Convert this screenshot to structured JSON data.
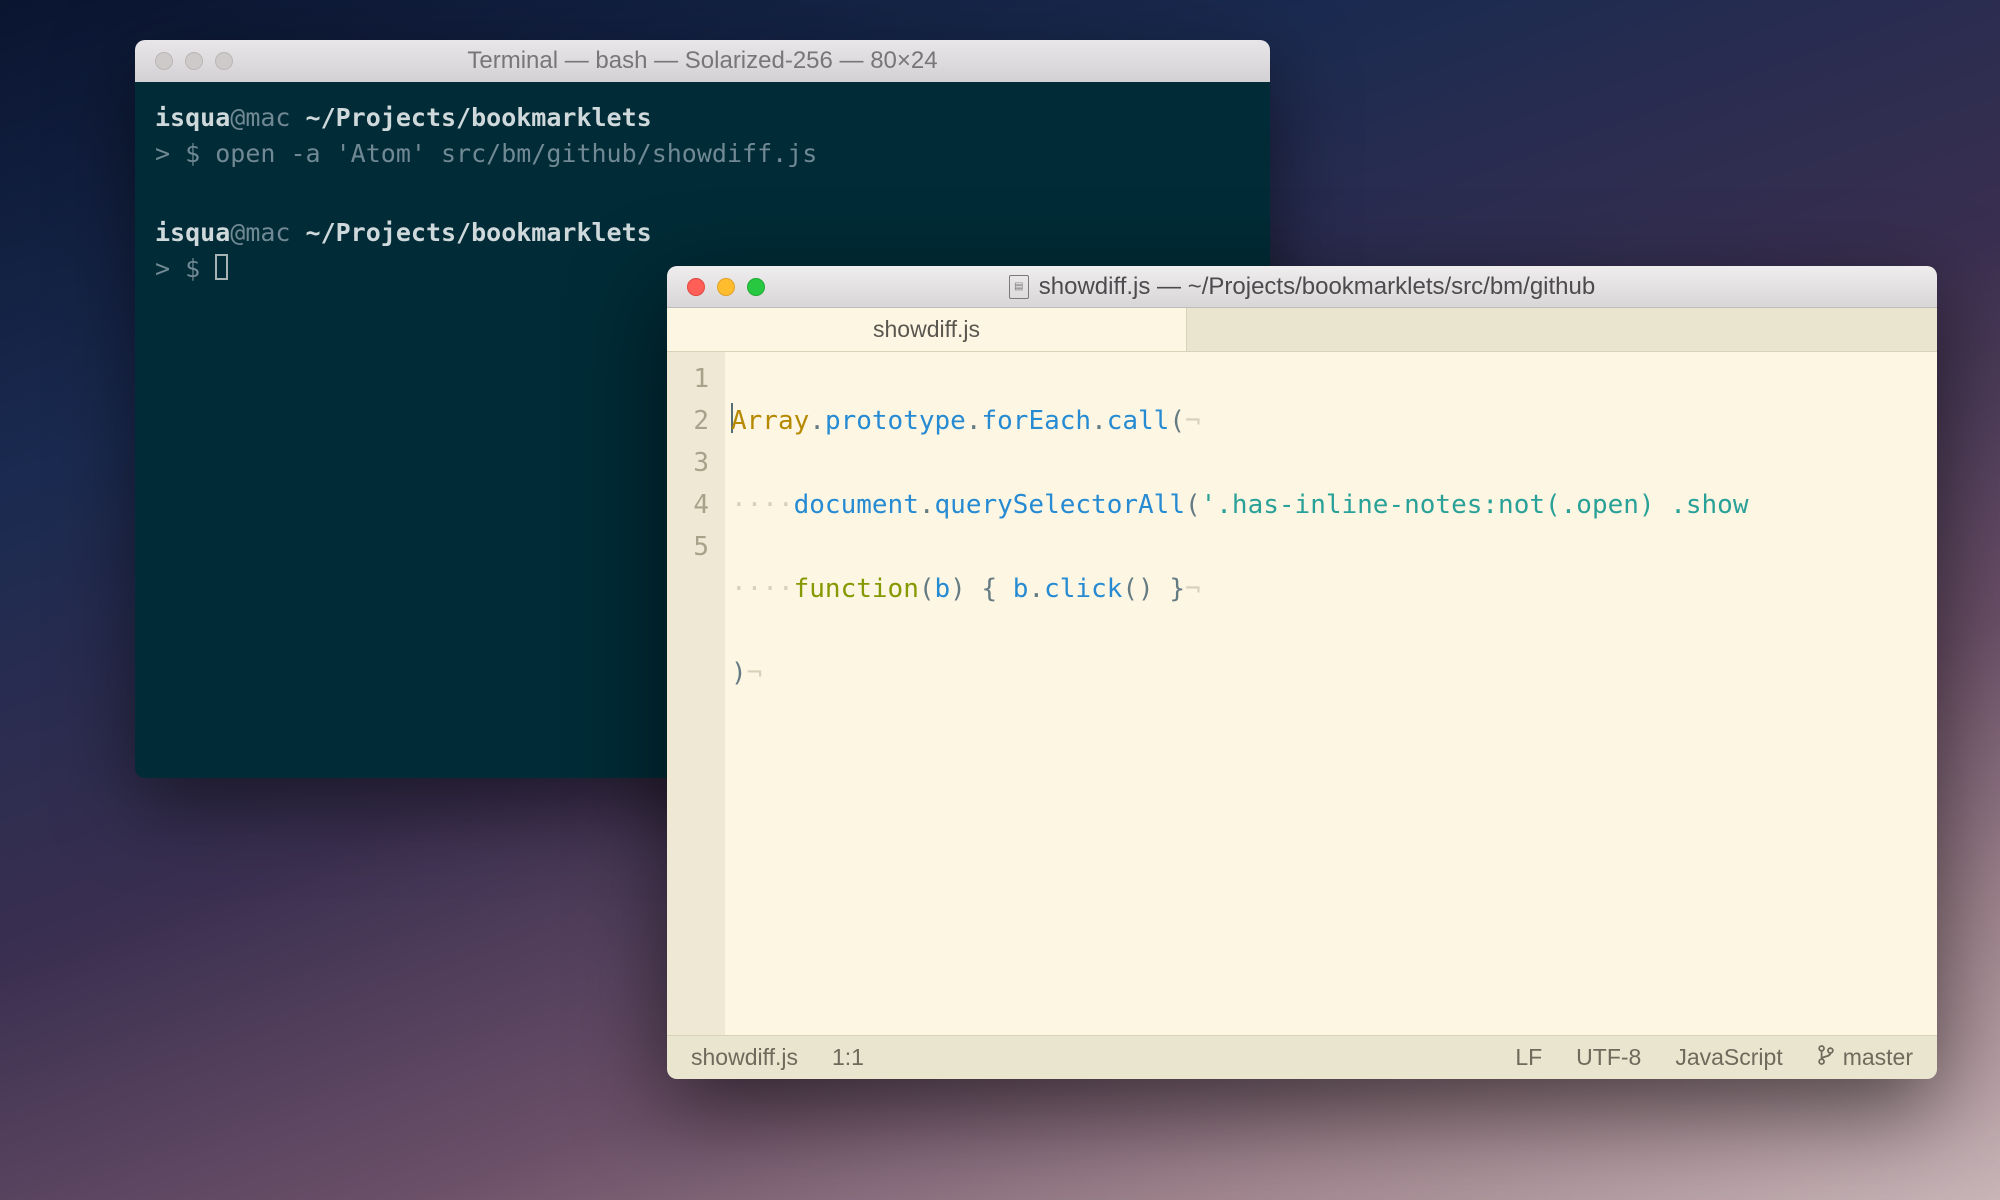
{
  "terminal": {
    "title": "Terminal — bash — Solarized-256 — 80×24",
    "line1": {
      "user": "isqua",
      "at": "@mac ",
      "path": "~/Projects/bookmarklets",
      "prompt": "> $ ",
      "cmd": "open -a 'Atom' src/bm/github/showdiff.js"
    },
    "line2": {
      "user": "isqua",
      "at": "@mac ",
      "path": "~/Projects/bookmarklets",
      "prompt": "> $ "
    }
  },
  "editor": {
    "title_file": "showdiff.js",
    "title_sep": " — ",
    "title_path": "~/Projects/bookmarklets/src/bm/github",
    "tab_label": "showdiff.js",
    "line_numbers": [
      "1",
      "2",
      "3",
      "4",
      "5"
    ],
    "code": {
      "l1": {
        "a": "Array",
        "dot": ".",
        "b": "prototype",
        "c": "forEach",
        "d": "call",
        "open": "(",
        "nl": "¬"
      },
      "l2": {
        "indent": "····",
        "a": "document",
        "dot": ".",
        "b": "querySelectorAll",
        "open": "(",
        "str": "'.has-inline-notes:not(.open) .show",
        "nl": ""
      },
      "l3": {
        "indent": "····",
        "kw": "function",
        "open": "(",
        "param": "b",
        "close": ") { ",
        "obj": "b",
        "dot": ".",
        "method": "click",
        "paren": "()",
        "end": " }",
        "nl": "¬"
      },
      "l4": {
        "close": ")",
        "nl": "¬"
      }
    },
    "status": {
      "file": "showdiff.js",
      "pos": "1:1",
      "eol": "LF",
      "encoding": "UTF-8",
      "language": "JavaScript",
      "branch": "master"
    }
  }
}
